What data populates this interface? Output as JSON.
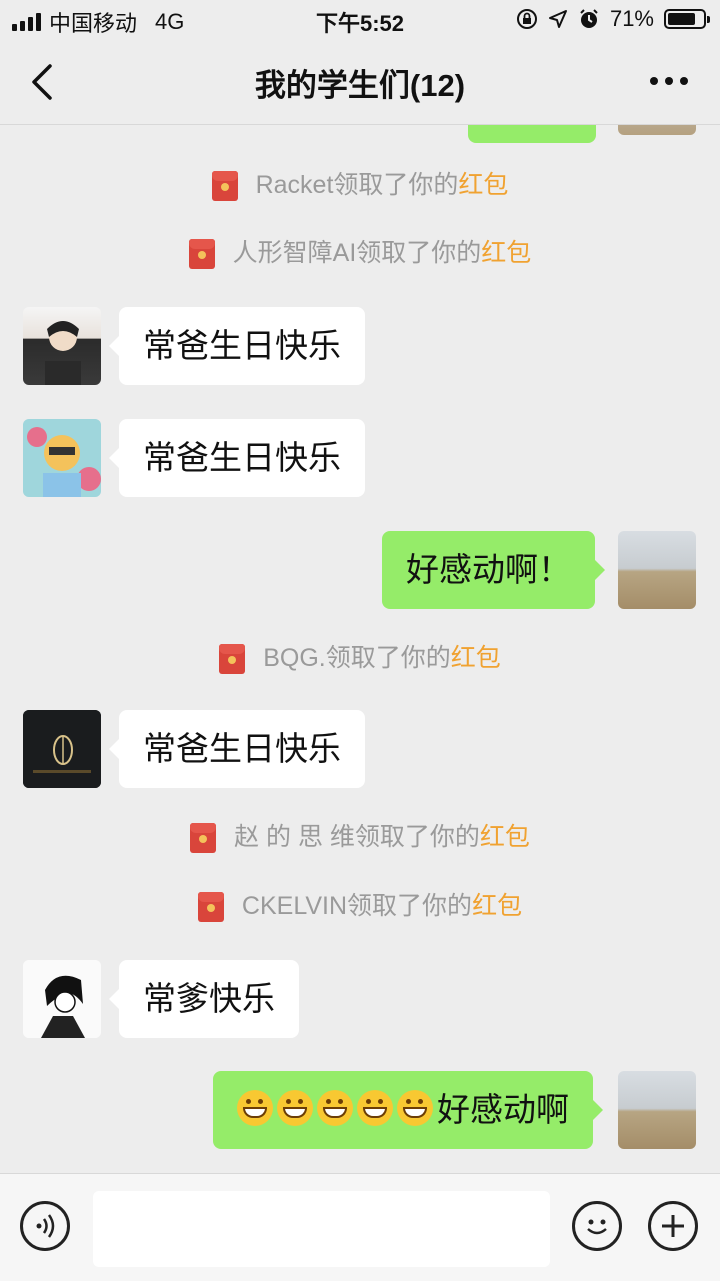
{
  "status_bar": {
    "carrier": "中国移动",
    "network": "4G",
    "time": "下午5:52",
    "battery": "71%"
  },
  "nav": {
    "title": "我的学生们(12)"
  },
  "messages": {
    "sys1": {
      "who": "Racket领取了你的",
      "link": "红包"
    },
    "sys2": {
      "who": "人形智障AI领取了你的",
      "link": "红包"
    },
    "msg1": {
      "text": "常爸生日快乐"
    },
    "msg2": {
      "text": "常爸生日快乐"
    },
    "msg3": {
      "text": "好感动啊！"
    },
    "sys3": {
      "who": "BQG.领取了你的",
      "link": "红包"
    },
    "msg4": {
      "text": "常爸生日快乐"
    },
    "sys4": {
      "who": "赵 的 思 维领取了你的",
      "link": "红包"
    },
    "sys5": {
      "who": "CKELVIN领取了你的",
      "link": "红包"
    },
    "msg5": {
      "text": "常爹快乐"
    },
    "msg6": {
      "text": "好感动啊"
    }
  },
  "colors": {
    "bubble_self": "#95ec69",
    "bubble_other": "#ffffff",
    "red_packet": "#f0a231",
    "background": "#ededed"
  }
}
